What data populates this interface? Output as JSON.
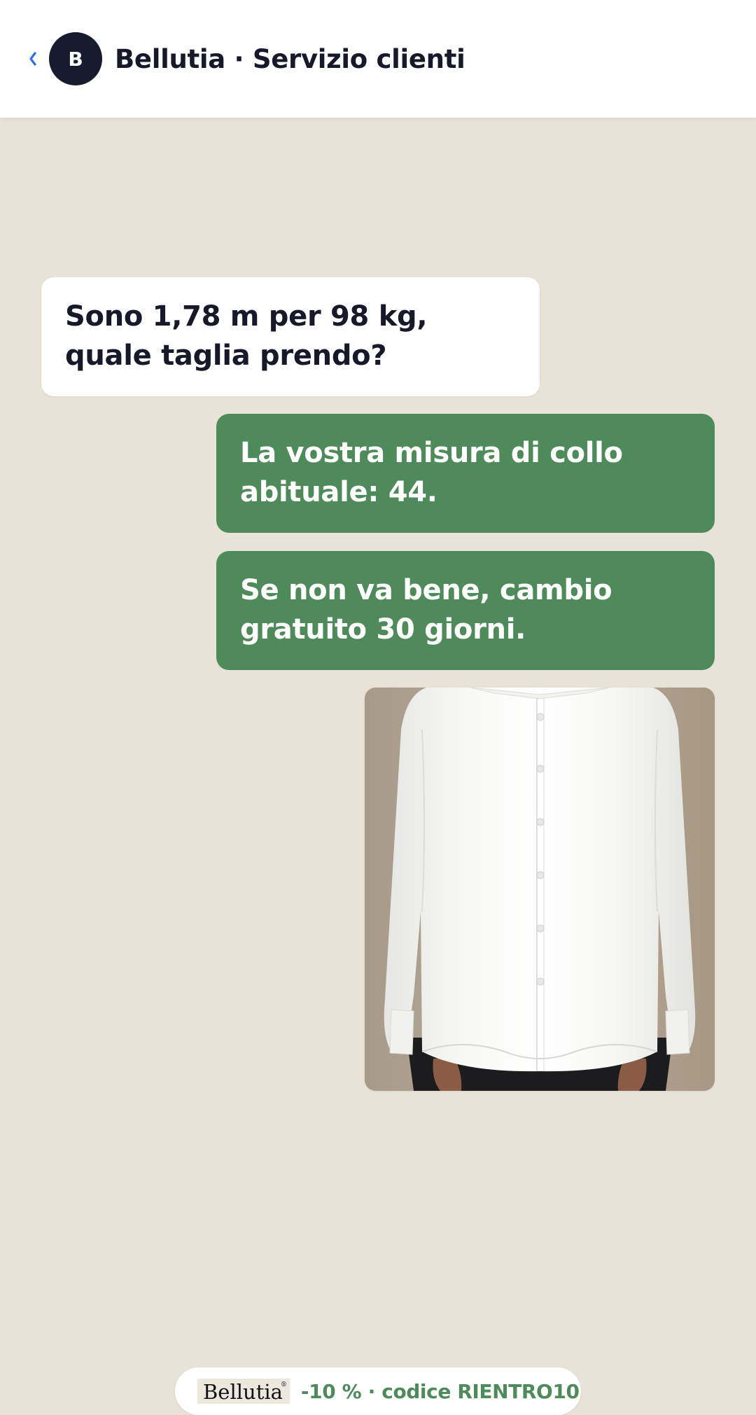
{
  "header": {
    "back_icon": "chevron-left-icon",
    "avatar_letter": "B",
    "title": "Bellutia · Servizio clienti"
  },
  "messages": [
    {
      "direction": "incoming",
      "text": "Sono 1,78 m per 98 kg, quale taglia prendo?"
    },
    {
      "direction": "outgoing",
      "text": "La vostra misura di collo abituale: 44."
    },
    {
      "direction": "outgoing",
      "text": "Se non va bene, cambio gratuito 30 giorni."
    }
  ],
  "attachment": {
    "type": "image",
    "subject": "white dress shirt"
  },
  "promo": {
    "logo_text": "Bellutia",
    "logo_mark": "®",
    "text": "-10 % · codice RIENTRO10"
  },
  "colors": {
    "background": "#e8e3d8",
    "header": "#ffffff",
    "avatar": "#161c2e",
    "incoming_bubble": "#ffffff",
    "outgoing_bubble": "#4f8b5a",
    "back_icon": "#2f6fe0",
    "promo_text": "#4f8b5a"
  }
}
